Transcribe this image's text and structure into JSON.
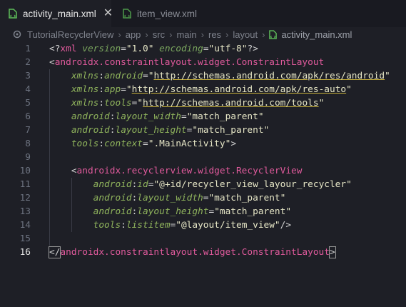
{
  "tabs": [
    {
      "label": "activity_main.xml",
      "active": true
    },
    {
      "label": "item_view.xml",
      "active": false
    }
  ],
  "breadcrumb": [
    "TutorialRecyclerView",
    "app",
    "src",
    "main",
    "res",
    "layout",
    "activity_main.xml"
  ],
  "current_line": 16,
  "code_lines": [
    [
      [
        "<?",
        "t-punct"
      ],
      [
        "xml",
        "t-pi"
      ],
      [
        " ",
        "t-punct"
      ],
      [
        "version",
        "t-attr"
      ],
      [
        "=",
        "t-punct"
      ],
      [
        "\"1.0\"",
        "t-val"
      ],
      [
        " ",
        "t-punct"
      ],
      [
        "encoding",
        "t-attr"
      ],
      [
        "=",
        "t-punct"
      ],
      [
        "\"utf-8\"",
        "t-val"
      ],
      [
        "?>",
        "t-punct"
      ]
    ],
    [
      [
        "<",
        "t-punct"
      ],
      [
        "androidx.constraintlayout.widget.ConstraintLayout",
        "t-tag"
      ]
    ],
    [
      [
        "    ",
        "t-punct"
      ],
      [
        "xmlns",
        "t-ns2"
      ],
      [
        ":",
        "t-punct"
      ],
      [
        "android",
        "t-ns2"
      ],
      [
        "=",
        "t-punct"
      ],
      [
        "\"",
        "t-val"
      ],
      [
        "http://schemas.android.com/apk/res/android",
        "t-url"
      ],
      [
        "\"",
        "t-val"
      ]
    ],
    [
      [
        "    ",
        "t-punct"
      ],
      [
        "xmlns",
        "t-ns2"
      ],
      [
        ":",
        "t-punct"
      ],
      [
        "app",
        "t-ns2"
      ],
      [
        "=",
        "t-punct"
      ],
      [
        "\"",
        "t-val"
      ],
      [
        "http://schemas.android.com/apk/res-auto",
        "t-url"
      ],
      [
        "\"",
        "t-val"
      ]
    ],
    [
      [
        "    ",
        "t-punct"
      ],
      [
        "xmlns",
        "t-ns2"
      ],
      [
        ":",
        "t-punct"
      ],
      [
        "tools",
        "t-ns2"
      ],
      [
        "=",
        "t-punct"
      ],
      [
        "\"",
        "t-val"
      ],
      [
        "http://schemas.android.com/tools",
        "t-url"
      ],
      [
        "\"",
        "t-val"
      ]
    ],
    [
      [
        "    ",
        "t-punct"
      ],
      [
        "android",
        "t-ns2"
      ],
      [
        ":",
        "t-punct"
      ],
      [
        "layout_width",
        "t-ns2"
      ],
      [
        "=",
        "t-punct"
      ],
      [
        "\"match_parent\"",
        "t-val"
      ]
    ],
    [
      [
        "    ",
        "t-punct"
      ],
      [
        "android",
        "t-ns2"
      ],
      [
        ":",
        "t-punct"
      ],
      [
        "layout_height",
        "t-ns2"
      ],
      [
        "=",
        "t-punct"
      ],
      [
        "\"match_parent\"",
        "t-val"
      ]
    ],
    [
      [
        "    ",
        "t-punct"
      ],
      [
        "tools",
        "t-ns2"
      ],
      [
        ":",
        "t-punct"
      ],
      [
        "context",
        "t-ns2"
      ],
      [
        "=",
        "t-punct"
      ],
      [
        "\".MainActivity\"",
        "t-val"
      ],
      [
        ">",
        "t-punct"
      ]
    ],
    [
      [
        "",
        "t-punct"
      ]
    ],
    [
      [
        "    ",
        "t-punct"
      ],
      [
        "<",
        "t-punct"
      ],
      [
        "androidx.recyclerview.widget.RecyclerView",
        "t-tag"
      ]
    ],
    [
      [
        "        ",
        "t-punct"
      ],
      [
        "android",
        "t-ns2"
      ],
      [
        ":",
        "t-punct"
      ],
      [
        "id",
        "t-ns2"
      ],
      [
        "=",
        "t-punct"
      ],
      [
        "\"@+id/recycler_view_layour_recycler\"",
        "t-val"
      ]
    ],
    [
      [
        "        ",
        "t-punct"
      ],
      [
        "android",
        "t-ns2"
      ],
      [
        ":",
        "t-punct"
      ],
      [
        "layout_width",
        "t-ns2"
      ],
      [
        "=",
        "t-punct"
      ],
      [
        "\"match_parent\"",
        "t-val"
      ]
    ],
    [
      [
        "        ",
        "t-punct"
      ],
      [
        "android",
        "t-ns2"
      ],
      [
        ":",
        "t-punct"
      ],
      [
        "layout_height",
        "t-ns2"
      ],
      [
        "=",
        "t-punct"
      ],
      [
        "\"match_parent\"",
        "t-val"
      ]
    ],
    [
      [
        "        ",
        "t-punct"
      ],
      [
        "tools",
        "t-ns2"
      ],
      [
        ":",
        "t-punct"
      ],
      [
        "listitem",
        "t-ns2"
      ],
      [
        "=",
        "t-punct"
      ],
      [
        "\"@layout/item_view\"",
        "t-val"
      ],
      [
        "/>",
        "t-punct"
      ]
    ],
    [
      [
        "",
        "t-punct"
      ]
    ],
    [
      [
        "</",
        "t-punct"
      ],
      [
        "androidx.constraintlayout.widget.ConstraintLayout",
        "t-tag"
      ],
      [
        ">",
        "t-punct"
      ]
    ]
  ]
}
